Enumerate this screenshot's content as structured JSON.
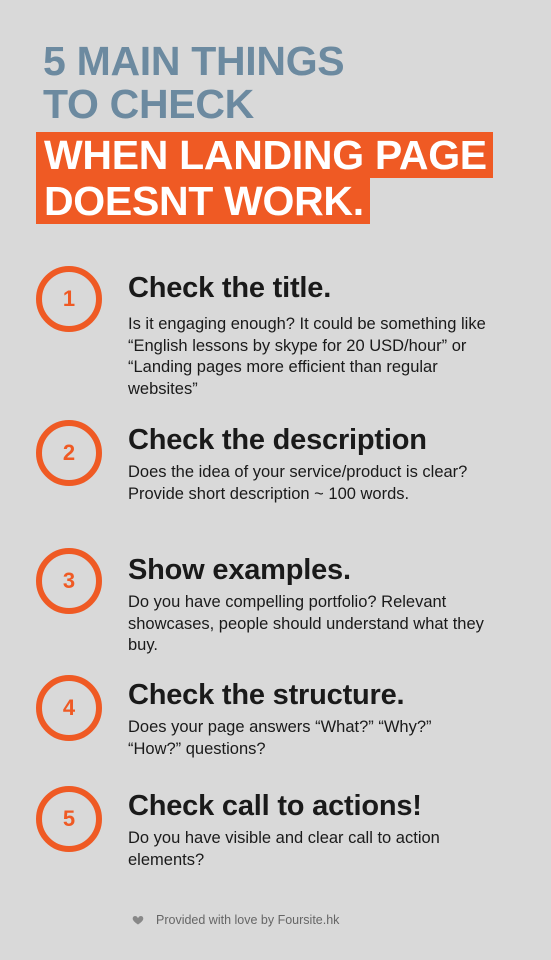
{
  "header": {
    "line1": "5 MAIN THINGS",
    "line2": "TO CHECK",
    "line3": "WHEN LANDING PAGE",
    "line4": "DOESNT WORK."
  },
  "colors": {
    "accent": "#ef5a24",
    "heading_gray": "#6c8aa0",
    "background": "#d9d9d9",
    "text": "#1a1a1a"
  },
  "items": [
    {
      "number": "1",
      "title": "Check the title.",
      "body": "Is it engaging enough? It could be something like “English lessons by skype for 20 USD/hour” or “Landing pages more efficient than regular websites”"
    },
    {
      "number": "2",
      "title": "Check the description",
      "body": "Does the idea of your service/product is clear? Provide short description ~ 100 words."
    },
    {
      "number": "3",
      "title": "Show examples.",
      "body": "Do you have compelling portfolio? Relevant showcases, people should understand what they buy."
    },
    {
      "number": "4",
      "title": "Check the structure.",
      "body": "Does your page answers “What?” “Why?” “How?” questions?"
    },
    {
      "number": "5",
      "title": "Check call to actions!",
      "body": "Do you have visible and clear call to action elements?"
    }
  ],
  "footer": {
    "icon": "heart-icon",
    "text": "Provided with love by Foursite.hk"
  }
}
